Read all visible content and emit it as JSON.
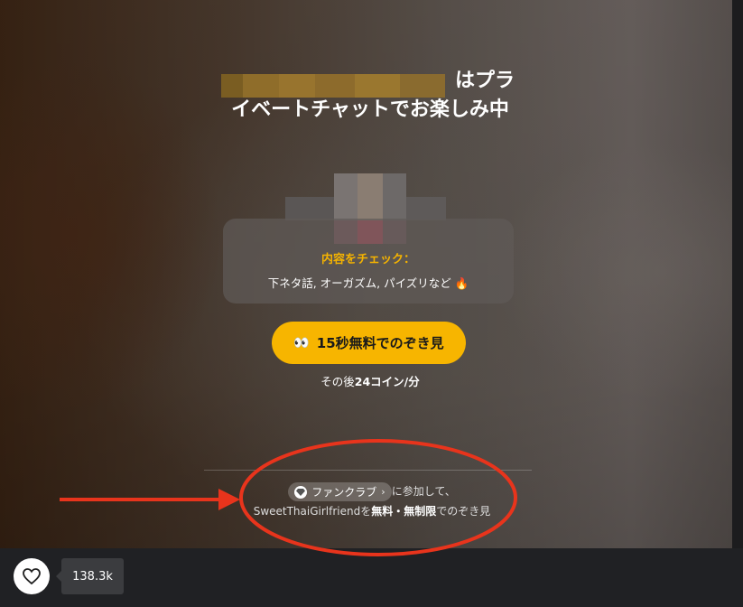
{
  "status": {
    "title": "はプライベートチャットでお楽しみ中"
  },
  "check_card": {
    "title": "内容をチェック：",
    "text": "下ネタ話, オーガズム, パイズリなど",
    "emoji": "🔥"
  },
  "peek_button": {
    "emoji": "👀",
    "label": "15秒無料でのぞき見"
  },
  "after_price": {
    "prefix": "その後",
    "price": "24コイン/分"
  },
  "fanclub": {
    "pill_label": "ファンクラブ",
    "join_text": "に参加して、",
    "model_name": "SweetThaiGirlfriend",
    "particle": "を",
    "free_label": "無料・無制限",
    "suffix": "でのぞき見"
  },
  "like": {
    "count": "138.3k"
  },
  "colors": {
    "accent": "#f7b500",
    "annotation": "#e8341c"
  }
}
